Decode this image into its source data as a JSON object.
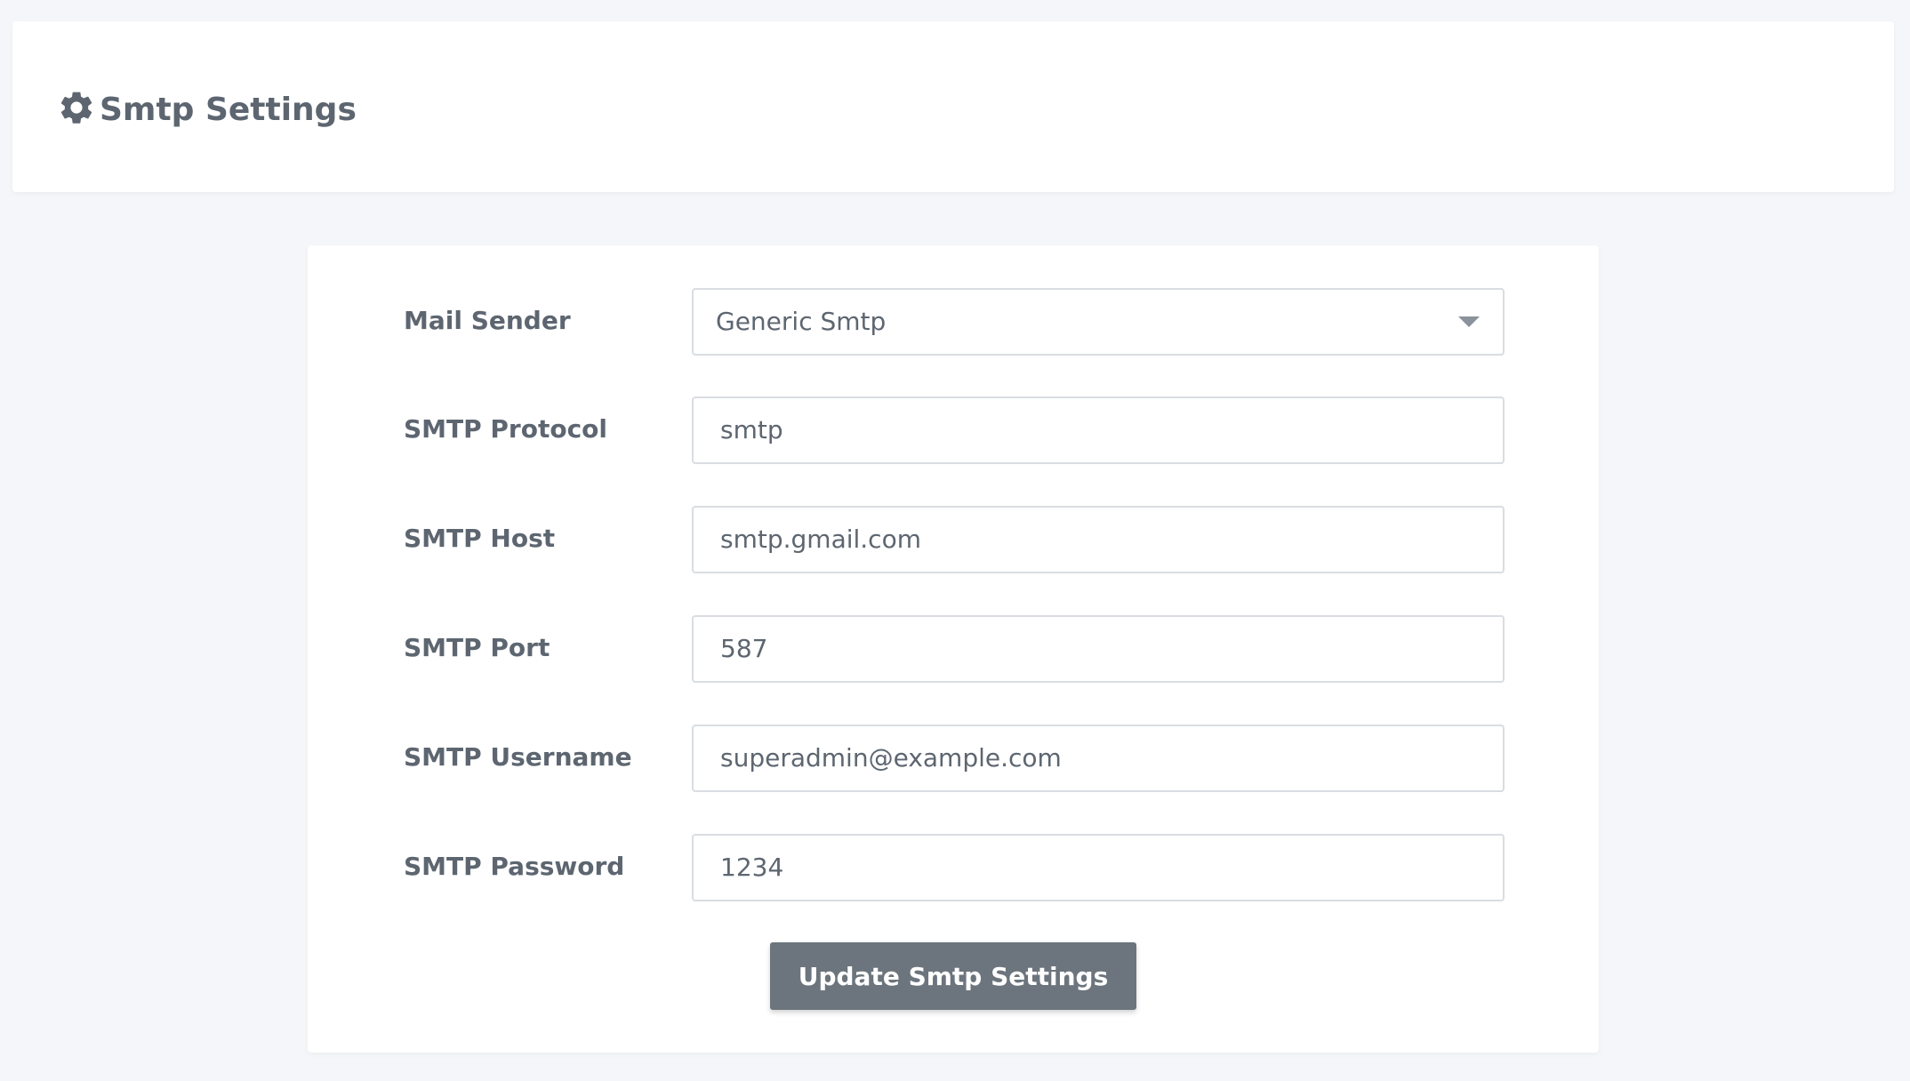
{
  "header": {
    "icon": "gear-icon",
    "title": "Smtp Settings"
  },
  "form": {
    "mail_sender": {
      "label": "Mail Sender",
      "value": "Generic Smtp"
    },
    "smtp_protocol": {
      "label": "SMTP Protocol",
      "value": "smtp"
    },
    "smtp_host": {
      "label": "SMTP Host",
      "value": "smtp.gmail.com"
    },
    "smtp_port": {
      "label": "SMTP Port",
      "value": "587"
    },
    "smtp_username": {
      "label": "SMTP Username",
      "value": "superadmin@example.com"
    },
    "smtp_password": {
      "label": "SMTP Password",
      "value": "1234"
    },
    "submit_label": "Update Smtp Settings"
  },
  "colors": {
    "button": "#6c757d",
    "text": "#5d6670",
    "background": "#f4f6f9"
  }
}
